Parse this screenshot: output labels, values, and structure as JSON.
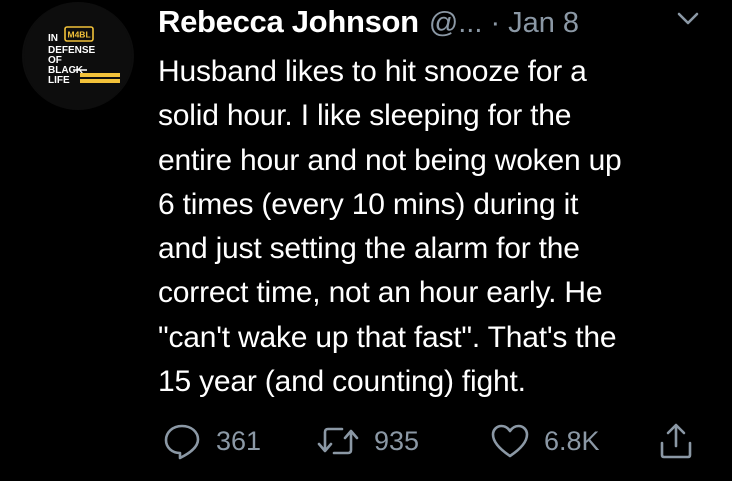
{
  "avatar": {
    "line1": "IN",
    "line2": "DEFENSE",
    "line3": "OF",
    "line4": "BLACK",
    "line5": "LIFE",
    "badge": "M4BL"
  },
  "header": {
    "display_name": "Rebecca Johnson",
    "handle": "@...",
    "separator": "·",
    "date": "Jan 8"
  },
  "body": {
    "lines": [
      "Husband likes to hit snooze for a",
      "solid hour. I like sleeping for the",
      "entire hour and not being woken up",
      "6 times (every 10 mins) during it",
      "and just setting the alarm for the",
      "correct time, not an hour early. He",
      "\"can't wake up that fast\". That's the",
      "15 year (and counting) fight."
    ]
  },
  "actions": {
    "replies": "361",
    "retweets": "935",
    "likes": "6.8K"
  },
  "colors": {
    "background": "#000000",
    "text": "#ffffff",
    "secondary": "#8b98a5",
    "badge": "#f2c23a"
  },
  "icons": {
    "reply": "reply-icon",
    "retweet": "retweet-icon",
    "like": "heart-icon",
    "share": "share-icon",
    "more": "chevron-down-icon"
  }
}
